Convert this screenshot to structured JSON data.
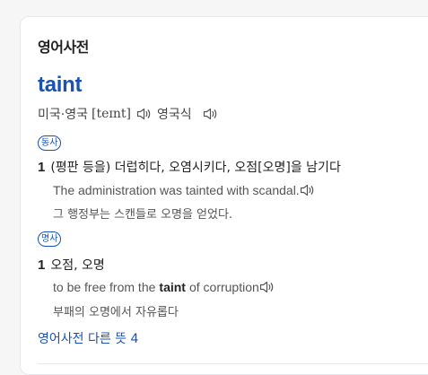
{
  "card": {
    "title": "영어사전",
    "word": "taint",
    "pronunciation": {
      "region_us_uk": "미국·영국",
      "ipa": "[teɪnt]",
      "region_uk": "영국식"
    },
    "senses": [
      {
        "pos": "동사",
        "number": "1",
        "meaning": "(평판 등을) 더럽히다, 오염시키다, 오점[오명]을 남기다",
        "example_en": "The administration was tainted with scandal.",
        "example_ko": "그 행정부는 스캔들로 오명을 얻었다."
      },
      {
        "pos": "명사",
        "number": "1",
        "meaning": "오점, 오명",
        "example_en_before": "to be free from the",
        "example_en_bold": "taint",
        "example_en_after": "of corruption",
        "example_ko": "부패의 오명에서 자유롭다"
      }
    ],
    "more_link": "영어사전 다른 뜻 4"
  },
  "colors": {
    "accent": "#1852b8",
    "text": "#222222",
    "muted": "#555555"
  },
  "icons": [
    "speaker-icon"
  ]
}
